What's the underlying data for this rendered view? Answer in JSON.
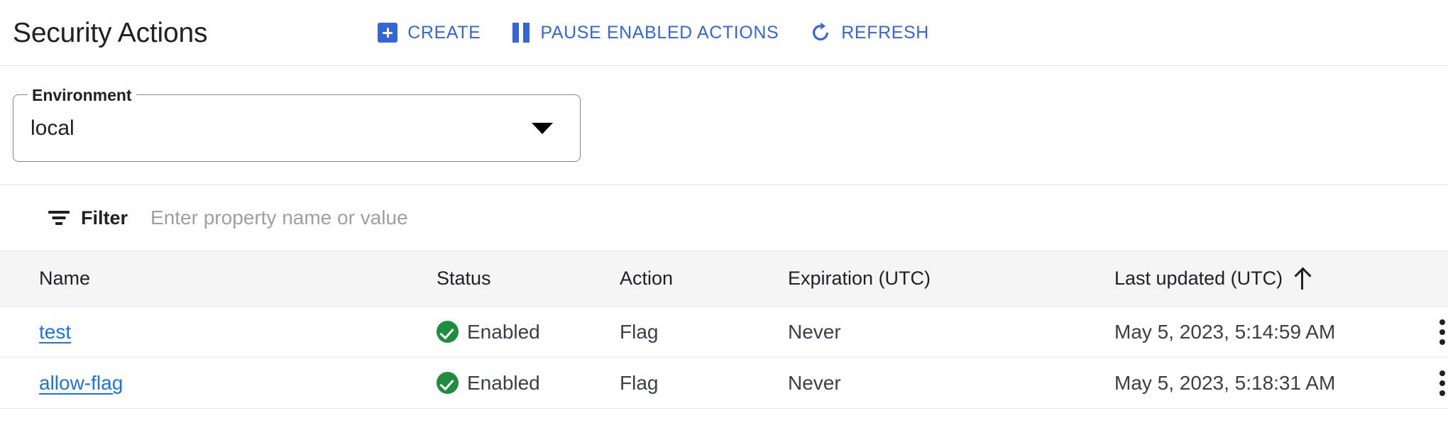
{
  "header": {
    "title": "Security Actions",
    "buttons": [
      {
        "label": "CREATE",
        "icon": "plus-square-icon"
      },
      {
        "label": "PAUSE ENABLED ACTIONS",
        "icon": "pause-icon"
      },
      {
        "label": "REFRESH",
        "icon": "refresh-icon"
      }
    ]
  },
  "environment": {
    "label": "Environment",
    "value": "local",
    "options": [
      "local"
    ]
  },
  "filter": {
    "label": "Filter",
    "placeholder": "Enter property name or value",
    "value": ""
  },
  "table": {
    "columns": [
      {
        "key": "name",
        "label": "Name"
      },
      {
        "key": "status",
        "label": "Status"
      },
      {
        "key": "action",
        "label": "Action"
      },
      {
        "key": "expiration",
        "label": "Expiration (UTC)"
      },
      {
        "key": "last_updated",
        "label": "Last updated (UTC)"
      }
    ],
    "sort": {
      "column": "last_updated",
      "direction": "ascending",
      "glyph": "arrow-up-icon"
    },
    "rows": [
      {
        "name": "test",
        "status": "Enabled",
        "status_icon": "check-circle-icon",
        "action": "Flag",
        "expiration": "Never",
        "last_updated": "May 5, 2023, 5:14:59 AM",
        "row_menu": "more-vert-icon"
      },
      {
        "name": "allow-flag",
        "status": "Enabled",
        "status_icon": "check-circle-icon",
        "action": "Flag",
        "expiration": "Never",
        "last_updated": "May 5, 2023, 5:18:31 AM",
        "row_menu": "more-vert-icon"
      }
    ]
  },
  "colors": {
    "accent_blue": "#3367d6",
    "link_blue": "#1a73e8",
    "success_green": "#1e8e3e",
    "text_primary": "#202124",
    "text_secondary": "#3c4043",
    "placeholder": "#9aa0a6",
    "header_row_bg": "#f5f5f5",
    "divider": "#e4e6e8"
  }
}
